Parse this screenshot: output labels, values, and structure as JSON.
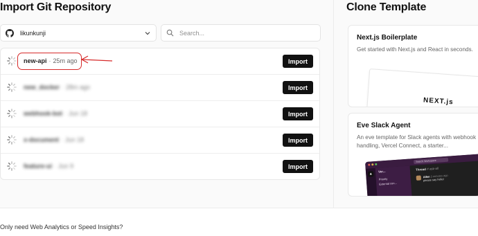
{
  "import_section": {
    "title": "Import Git Repository",
    "owner": "likunkunji",
    "search_placeholder": "Search...",
    "import_label": "Import",
    "repos": [
      {
        "name": "new-api",
        "age": "25m ago",
        "blurred": false
      },
      {
        "name": "new_docker",
        "age": "28m ago",
        "blurred": true
      },
      {
        "name": "webhook-bot",
        "age": "Jun 18",
        "blurred": true
      },
      {
        "name": "x-document",
        "age": "Jun 18",
        "blurred": true
      },
      {
        "name": "feature-ui",
        "age": "Jun 9",
        "blurred": true
      }
    ]
  },
  "clone_section": {
    "title": "Clone Template",
    "cards": [
      {
        "title": "Next.js Boilerplate",
        "description": "Get started with Next.js and React in seconds.",
        "preview_logo": "NEXT.js"
      },
      {
        "title": "Eve Slack Agent",
        "description": "An eve template for Slack agents with webhook handling, Vercel Connect, a starter...",
        "preview": {
          "search": "Search Workspace",
          "workspace": "Ver...",
          "channel": "Thread",
          "channel_tag": "# ask-all",
          "sidebar_item_1": "Priority",
          "sidebar_item_2": "External con...",
          "user": "Allen",
          "time": "3 minutes ago",
          "message": "please say hello!"
        }
      }
    ]
  },
  "footer": {
    "text": "Only need Web Analytics or Speed Insights?"
  },
  "colors": {
    "accent": "#111111",
    "annotation": "#d62828",
    "page_bg": "#fafafa"
  }
}
